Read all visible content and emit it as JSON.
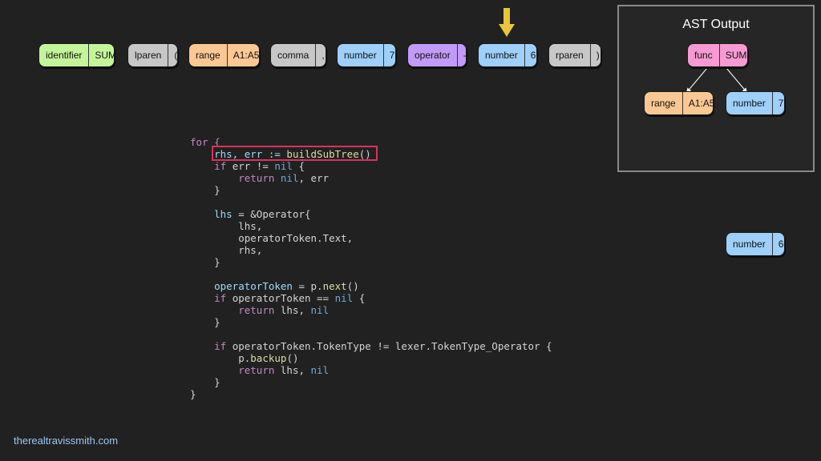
{
  "tokens": [
    {
      "type": "identifier",
      "value": "SUM",
      "color": "#c5f59b"
    },
    {
      "type": "lparen",
      "value": "(",
      "color": "#c7c7c7"
    },
    {
      "type": "range",
      "value": "A1:A5",
      "color": "#fbc894"
    },
    {
      "type": "comma",
      "value": ",",
      "color": "#c7c7c7"
    },
    {
      "type": "number",
      "value": "7",
      "color": "#9ed0fb"
    },
    {
      "type": "operator",
      "value": "-",
      "color": "#c29bf8"
    },
    {
      "type": "number",
      "value": "6",
      "color": "#9ed0fb"
    },
    {
      "type": "rparen",
      "value": ")",
      "color": "#c7c7c7"
    }
  ],
  "current_token_arrow": {
    "icon": "down-arrow-icon",
    "color": "#e8c53a",
    "points_to_token": 6
  },
  "ast": {
    "title": "AST Output",
    "root": {
      "type": "func",
      "value": "SUM"
    },
    "children": [
      {
        "type": "range",
        "value": "A1:A5"
      },
      {
        "type": "number",
        "value": "7"
      }
    ]
  },
  "pending_node": {
    "type": "number",
    "value": "6"
  },
  "code": {
    "l1": "for {",
    "l2a": "rhs, err := ",
    "l2b": "buildSubTree",
    "l2c": "()",
    "l3a": "if",
    "l3b": " err != ",
    "l3c": "nil",
    "l3d": " {",
    "l4a": "return",
    "l4b": " ",
    "l4c": "nil",
    "l4d": ", err",
    "l5": "}",
    "l6a": "lhs",
    "l6b": " = &Operator{",
    "l7": "lhs,",
    "l8": "operatorToken.Text,",
    "l9": "rhs,",
    "l10": "}",
    "l11a": "operatorToken",
    "l11b": " = p.",
    "l11c": "next",
    "l11d": "()",
    "l12a": "if",
    "l12b": " operatorToken == ",
    "l12c": "nil",
    "l12d": " {",
    "l13a": "return",
    "l13b": " lhs, ",
    "l13c": "nil",
    "l14": "}",
    "l15a": "if",
    "l15b": " operatorToken.TokenType != lexer.TokenType_Operator {",
    "l16a": "p.",
    "l16b": "backup",
    "l16c": "()",
    "l17a": "return",
    "l17b": " lhs, ",
    "l17c": "nil",
    "l18": "}",
    "l19": "}"
  },
  "highlight_color": "#d9325e",
  "footer": "therealtravissmith.com"
}
